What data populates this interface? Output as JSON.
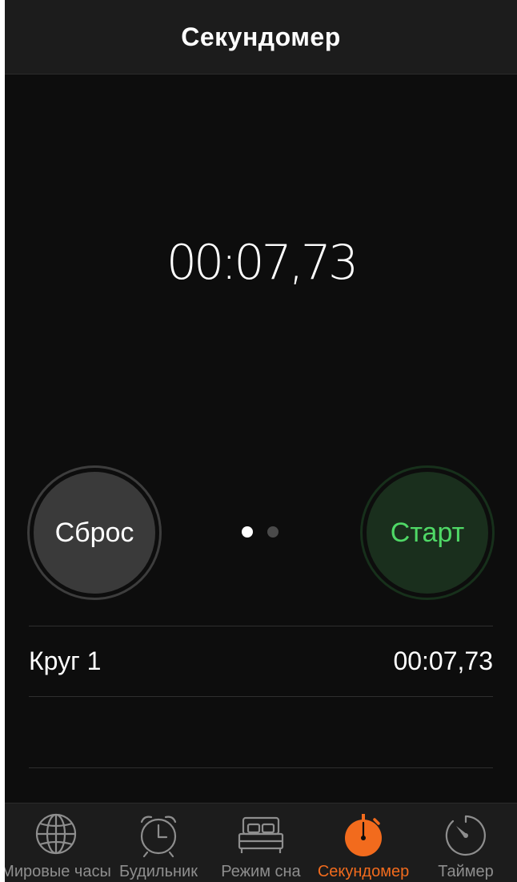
{
  "colors": {
    "accent": "#f26b1d",
    "start_green": "#4fd866",
    "start_bg": "#1a2f1d",
    "reset_bg": "#3a3a3a",
    "background": "#0d0d0d",
    "inactive_tab": "#8e8e8e"
  },
  "navbar": {
    "title": "Секундомер"
  },
  "stopwatch": {
    "time": "00:07,73"
  },
  "controls": {
    "reset_label": "Сброс",
    "start_label": "Старт",
    "page_count": 2,
    "current_page": 1
  },
  "laps": [
    {
      "label": "Круг 1",
      "time": "00:07,73"
    }
  ],
  "tabbar": {
    "tabs": [
      {
        "label": "Мировые часы",
        "icon": "globe-icon",
        "active": false
      },
      {
        "label": "Будильник",
        "icon": "alarm-clock-icon",
        "active": false
      },
      {
        "label": "Режим сна",
        "icon": "bed-icon",
        "active": false
      },
      {
        "label": "Секундомер",
        "icon": "stopwatch-icon",
        "active": true
      },
      {
        "label": "Таймер",
        "icon": "timer-icon",
        "active": false
      }
    ]
  }
}
